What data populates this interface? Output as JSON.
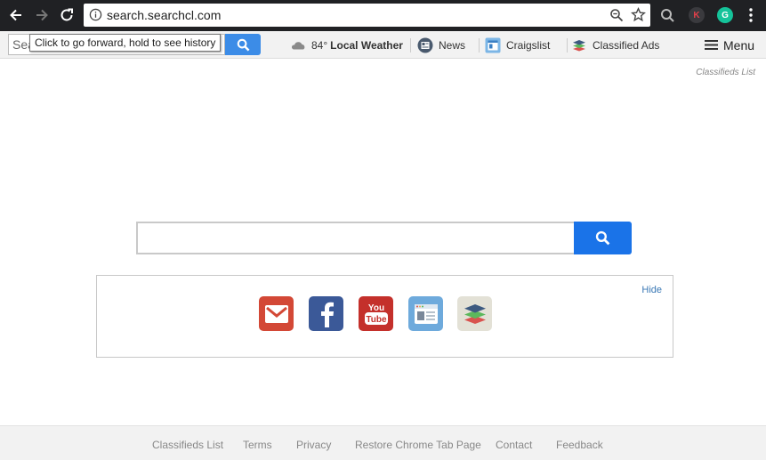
{
  "browser": {
    "url": "search.searchcl.com",
    "tooltip": "Click to go forward, hold to see history"
  },
  "toolbar": {
    "search_placeholder": "Search",
    "weather": {
      "temp": "84°",
      "label": "Local Weather"
    },
    "items": [
      {
        "label": "News",
        "icon": "news-icon"
      },
      {
        "label": "Craigslist",
        "icon": "craigslist-icon"
      },
      {
        "label": "Classified Ads",
        "icon": "stack-icon"
      }
    ],
    "menu_label": "Menu"
  },
  "page": {
    "classifieds_link": "Classifieds List",
    "hide_label": "Hide",
    "shortcuts": [
      {
        "icon": "gmail-icon",
        "color": "#d34836"
      },
      {
        "icon": "facebook-icon",
        "color": "#3b5998"
      },
      {
        "icon": "youtube-icon",
        "color": "#c4302b"
      },
      {
        "icon": "news-window-icon",
        "color": "#5ea0d8"
      },
      {
        "icon": "layers-icon",
        "color": "#e3e1d6"
      }
    ]
  },
  "footer": {
    "links": [
      "Classifieds List",
      "Terms",
      "Privacy",
      "Restore Chrome Tab Page",
      "Contact",
      "Feedback"
    ]
  },
  "colors": {
    "accent": "#1a73e8",
    "chrome": "#202124"
  }
}
